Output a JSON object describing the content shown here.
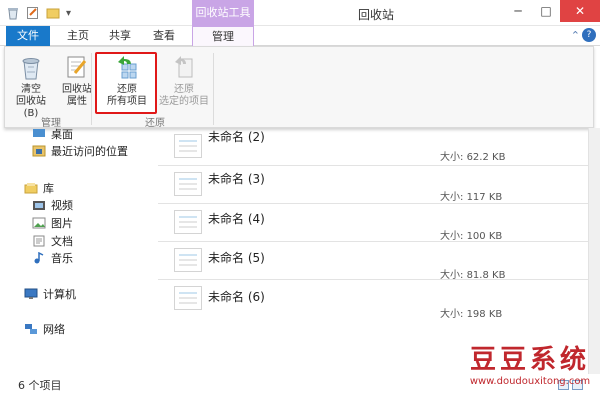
{
  "window": {
    "title": "回收站",
    "context_group": "回收站工具",
    "controls": {
      "minimize": "─",
      "maximize": "□",
      "close": "✕"
    }
  },
  "quick_access": {
    "dropdown": "▾"
  },
  "ribbon_tabs": [
    "文件",
    "主页",
    "共享",
    "查看",
    "管理"
  ],
  "help": {
    "chevron": "⌃",
    "question": "?"
  },
  "ribbon": {
    "manage_group": {
      "label": "管理",
      "empty_bin": [
        "清空",
        "回收站(B)"
      ],
      "properties": [
        "回收站",
        "属性"
      ]
    },
    "restore_group": {
      "label": "还原",
      "restore_all": [
        "还原",
        "所有项目"
      ],
      "restore_selected": [
        "还原",
        "选定的项目"
      ]
    }
  },
  "nav": {
    "desktop": "桌面",
    "recent": "最近访问的位置",
    "libraries": "库",
    "videos": "视频",
    "pictures": "图片",
    "documents": "文档",
    "music": "音乐",
    "computer": "计算机",
    "network": "网络"
  },
  "files": {
    "size_label": "大小:",
    "items": [
      {
        "name": "未命名 (2)",
        "size": "62.2 KB"
      },
      {
        "name": "未命名 (3)",
        "size": "117 KB"
      },
      {
        "name": "未命名 (4)",
        "size": "100 KB"
      },
      {
        "name": "未命名 (5)",
        "size": "81.8 KB"
      },
      {
        "name": "未命名 (6)",
        "size": "198 KB"
      }
    ]
  },
  "status": {
    "count": "6 个项目"
  },
  "watermark": {
    "cn": "豆豆系统",
    "url": "www.doudouxitong.com"
  },
  "colors": {
    "accent": "#1979ca",
    "context": "#c9a5e6",
    "highlight": "#e01818",
    "close": "#e04343",
    "watermark": "#c0272d"
  }
}
